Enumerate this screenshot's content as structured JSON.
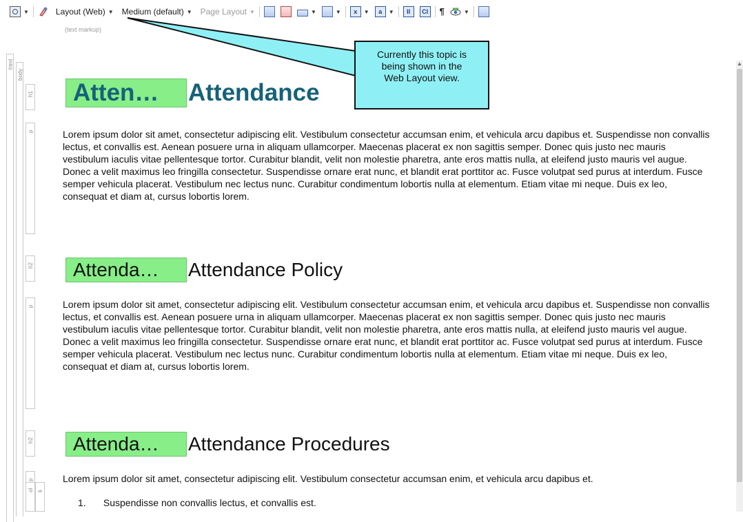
{
  "toolbar": {
    "layout_label": "Layout (Web)",
    "medium_label": "Medium (default)",
    "page_layout_label": "Page Layout",
    "markup_label": "(text markup)"
  },
  "structure": {
    "html_label": "html",
    "body_label": "body",
    "tags": [
      "h1",
      "p",
      "h2",
      "p",
      "h2",
      "p",
      "ol",
      "li"
    ]
  },
  "callout": {
    "line1": "Currently this topic is",
    "line2": "being shown in the",
    "line3": "Web Layout view."
  },
  "sections": [
    {
      "cond_label": "Atten…",
      "heading": "Attendance",
      "paragraph": "Lorem ipsum dolor sit amet, consectetur adipiscing elit. Vestibulum consectetur accumsan enim, et vehicula arcu dapibus et. Suspendisse non convallis lectus, et convallis est. Aenean posuere urna in aliquam ullamcorper. Maecenas placerat ex non sagittis semper. Donec quis justo nec mauris vestibulum iaculis vitae pellentesque tortor. Curabitur blandit, velit non molestie pharetra, ante eros mattis nulla, at eleifend justo mauris vel augue. Donec a velit maximus leo fringilla consectetur. Suspendisse ornare erat nunc, et blandit erat porttitor ac. Fusce volutpat sed purus at interdum. Fusce semper vehicula placerat. Vestibulum nec lectus nunc. Curabitur condimentum lobortis nulla at elementum. Etiam vitae mi neque. Duis ex leo, consequat et diam at, cursus lobortis lorem."
    },
    {
      "cond_label": "Attenda…",
      "heading": "Attendance Policy",
      "paragraph": "Lorem ipsum dolor sit amet, consectetur adipiscing elit. Vestibulum consectetur accumsan enim, et vehicula arcu dapibus et. Suspendisse non convallis lectus, et convallis est. Aenean posuere urna in aliquam ullamcorper. Maecenas placerat ex non sagittis semper. Donec quis justo nec mauris vestibulum iaculis vitae pellentesque tortor. Curabitur blandit, velit non molestie pharetra, ante eros mattis nulla, at eleifend justo mauris vel augue. Donec a velit maximus leo fringilla consectetur. Suspendisse ornare erat nunc, et blandit erat porttitor ac. Fusce volutpat sed purus at interdum. Fusce semper vehicula placerat. Vestibulum nec lectus nunc. Curabitur condimentum lobortis nulla at elementum. Etiam vitae mi neque. Duis ex leo, consequat et diam at, cursus lobortis lorem."
    },
    {
      "cond_label": "Attenda…",
      "heading": "Attendance Procedures",
      "paragraph": "Lorem ipsum dolor sit amet, consectetur adipiscing elit. Vestibulum consectetur accumsan enim, et vehicula arcu dapibus et."
    }
  ],
  "list": {
    "items": [
      {
        "num": "1.",
        "text": "Suspendisse non convallis lectus, et convallis est."
      }
    ]
  },
  "colors": {
    "condition_tag": "#88ee88",
    "h1": "#17617a",
    "callout": "#8ef0f4"
  }
}
